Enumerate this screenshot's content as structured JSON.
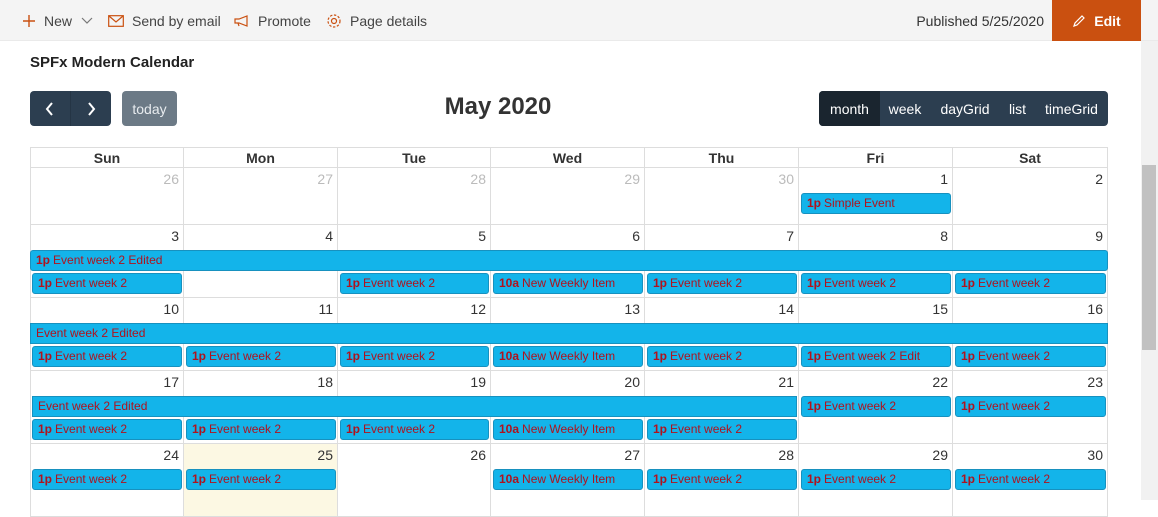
{
  "commandbar": {
    "new_label": "New",
    "email_label": "Send by email",
    "promote_label": "Promote",
    "page_details_label": "Page details",
    "published_label": "Published 5/25/2020",
    "edit_label": "Edit"
  },
  "webpart": {
    "title": "SPFx Modern Calendar"
  },
  "calendar": {
    "today_label": "today",
    "title": "May 2020",
    "views": [
      "month",
      "week",
      "dayGrid",
      "list",
      "timeGrid"
    ],
    "active_view": "month",
    "weekdays": [
      "Sun",
      "Mon",
      "Tue",
      "Wed",
      "Thu",
      "Fri",
      "Sat"
    ],
    "weeks": [
      [
        {
          "d": "26",
          "other": true
        },
        {
          "d": "27",
          "other": true
        },
        {
          "d": "28",
          "other": true
        },
        {
          "d": "29",
          "other": true
        },
        {
          "d": "30",
          "other": true
        },
        {
          "d": "1"
        },
        {
          "d": "2"
        }
      ],
      [
        {
          "d": "3"
        },
        {
          "d": "4"
        },
        {
          "d": "5"
        },
        {
          "d": "6"
        },
        {
          "d": "7"
        },
        {
          "d": "8"
        },
        {
          "d": "9"
        }
      ],
      [
        {
          "d": "10"
        },
        {
          "d": "11"
        },
        {
          "d": "12"
        },
        {
          "d": "13"
        },
        {
          "d": "14"
        },
        {
          "d": "15"
        },
        {
          "d": "16"
        }
      ],
      [
        {
          "d": "17"
        },
        {
          "d": "18"
        },
        {
          "d": "19"
        },
        {
          "d": "20"
        },
        {
          "d": "21"
        },
        {
          "d": "22"
        },
        {
          "d": "23"
        }
      ],
      [
        {
          "d": "24"
        },
        {
          "d": "25",
          "today": true
        },
        {
          "d": "26"
        },
        {
          "d": "27"
        },
        {
          "d": "28"
        },
        {
          "d": "29"
        },
        {
          "d": "30"
        }
      ]
    ],
    "events": [
      {
        "week": 0,
        "start": 5,
        "span": 1,
        "slot": 0,
        "time": "1p",
        "title": "Simple Event"
      },
      {
        "week": 1,
        "start": 0,
        "span": 7,
        "slot": 0,
        "time": "1p",
        "title": "Event week 2 Edited"
      },
      {
        "week": 1,
        "start": 0,
        "span": 1,
        "slot": 1,
        "time": "1p",
        "title": "Event week 2"
      },
      {
        "week": 1,
        "start": 2,
        "span": 1,
        "slot": 1,
        "time": "1p",
        "title": "Event week 2"
      },
      {
        "week": 1,
        "start": 3,
        "span": 1,
        "slot": 1,
        "time": "10a",
        "title": "New Weekly Item"
      },
      {
        "week": 1,
        "start": 4,
        "span": 1,
        "slot": 1,
        "time": "1p",
        "title": "Event week 2"
      },
      {
        "week": 1,
        "start": 5,
        "span": 1,
        "slot": 1,
        "time": "1p",
        "title": "Event week 2"
      },
      {
        "week": 1,
        "start": 6,
        "span": 1,
        "slot": 1,
        "time": "1p",
        "title": "Event week 2"
      },
      {
        "week": 2,
        "start": 0,
        "span": 7,
        "slot": 0,
        "time": "",
        "title": "Event week 2 Edited"
      },
      {
        "week": 2,
        "start": 0,
        "span": 1,
        "slot": 1,
        "time": "1p",
        "title": "Event week 2"
      },
      {
        "week": 2,
        "start": 1,
        "span": 1,
        "slot": 1,
        "time": "1p",
        "title": "Event week 2"
      },
      {
        "week": 2,
        "start": 2,
        "span": 1,
        "slot": 1,
        "time": "1p",
        "title": "Event week 2"
      },
      {
        "week": 2,
        "start": 3,
        "span": 1,
        "slot": 1,
        "time": "10a",
        "title": "New Weekly Item"
      },
      {
        "week": 2,
        "start": 4,
        "span": 1,
        "slot": 1,
        "time": "1p",
        "title": "Event week 2"
      },
      {
        "week": 2,
        "start": 5,
        "span": 1,
        "slot": 1,
        "time": "1p",
        "title": "Event week 2 Edit"
      },
      {
        "week": 2,
        "start": 6,
        "span": 1,
        "slot": 1,
        "time": "1p",
        "title": "Event week 2"
      },
      {
        "week": 3,
        "start": 0,
        "span": 5,
        "slot": 0,
        "time": "",
        "title": "Event week 2 Edited"
      },
      {
        "week": 3,
        "start": 5,
        "span": 1,
        "slot": 0,
        "time": "1p",
        "title": "Event week 2"
      },
      {
        "week": 3,
        "start": 6,
        "span": 1,
        "slot": 0,
        "time": "1p",
        "title": "Event week 2"
      },
      {
        "week": 3,
        "start": 0,
        "span": 1,
        "slot": 1,
        "time": "1p",
        "title": "Event week 2"
      },
      {
        "week": 3,
        "start": 1,
        "span": 1,
        "slot": 1,
        "time": "1p",
        "title": "Event week 2"
      },
      {
        "week": 3,
        "start": 2,
        "span": 1,
        "slot": 1,
        "time": "1p",
        "title": "Event week 2"
      },
      {
        "week": 3,
        "start": 3,
        "span": 1,
        "slot": 1,
        "time": "10a",
        "title": "New Weekly Item"
      },
      {
        "week": 3,
        "start": 4,
        "span": 1,
        "slot": 1,
        "time": "1p",
        "title": "Event week 2"
      },
      {
        "week": 4,
        "start": 0,
        "span": 1,
        "slot": 0,
        "time": "1p",
        "title": "Event week 2"
      },
      {
        "week": 4,
        "start": 1,
        "span": 1,
        "slot": 0,
        "time": "1p",
        "title": "Event week 2"
      },
      {
        "week": 4,
        "start": 3,
        "span": 1,
        "slot": 0,
        "time": "10a",
        "title": "New Weekly Item"
      },
      {
        "week": 4,
        "start": 4,
        "span": 1,
        "slot": 0,
        "time": "1p",
        "title": "Event week 2"
      },
      {
        "week": 4,
        "start": 5,
        "span": 1,
        "slot": 0,
        "time": "1p",
        "title": "Event week 2"
      },
      {
        "week": 4,
        "start": 6,
        "span": 1,
        "slot": 0,
        "time": "1p",
        "title": "Event week 2"
      }
    ]
  },
  "colors": {
    "accent": "#ca5010",
    "event_bg": "#13b4ea",
    "event_text": "#b0121d",
    "toolbar": "#2c3e50",
    "today_bg": "#fcf8e3"
  },
  "icons": {
    "new": "plus-icon",
    "email": "mail-icon",
    "promote": "megaphone-icon",
    "details": "gear-icon",
    "edit": "pencil-icon"
  }
}
